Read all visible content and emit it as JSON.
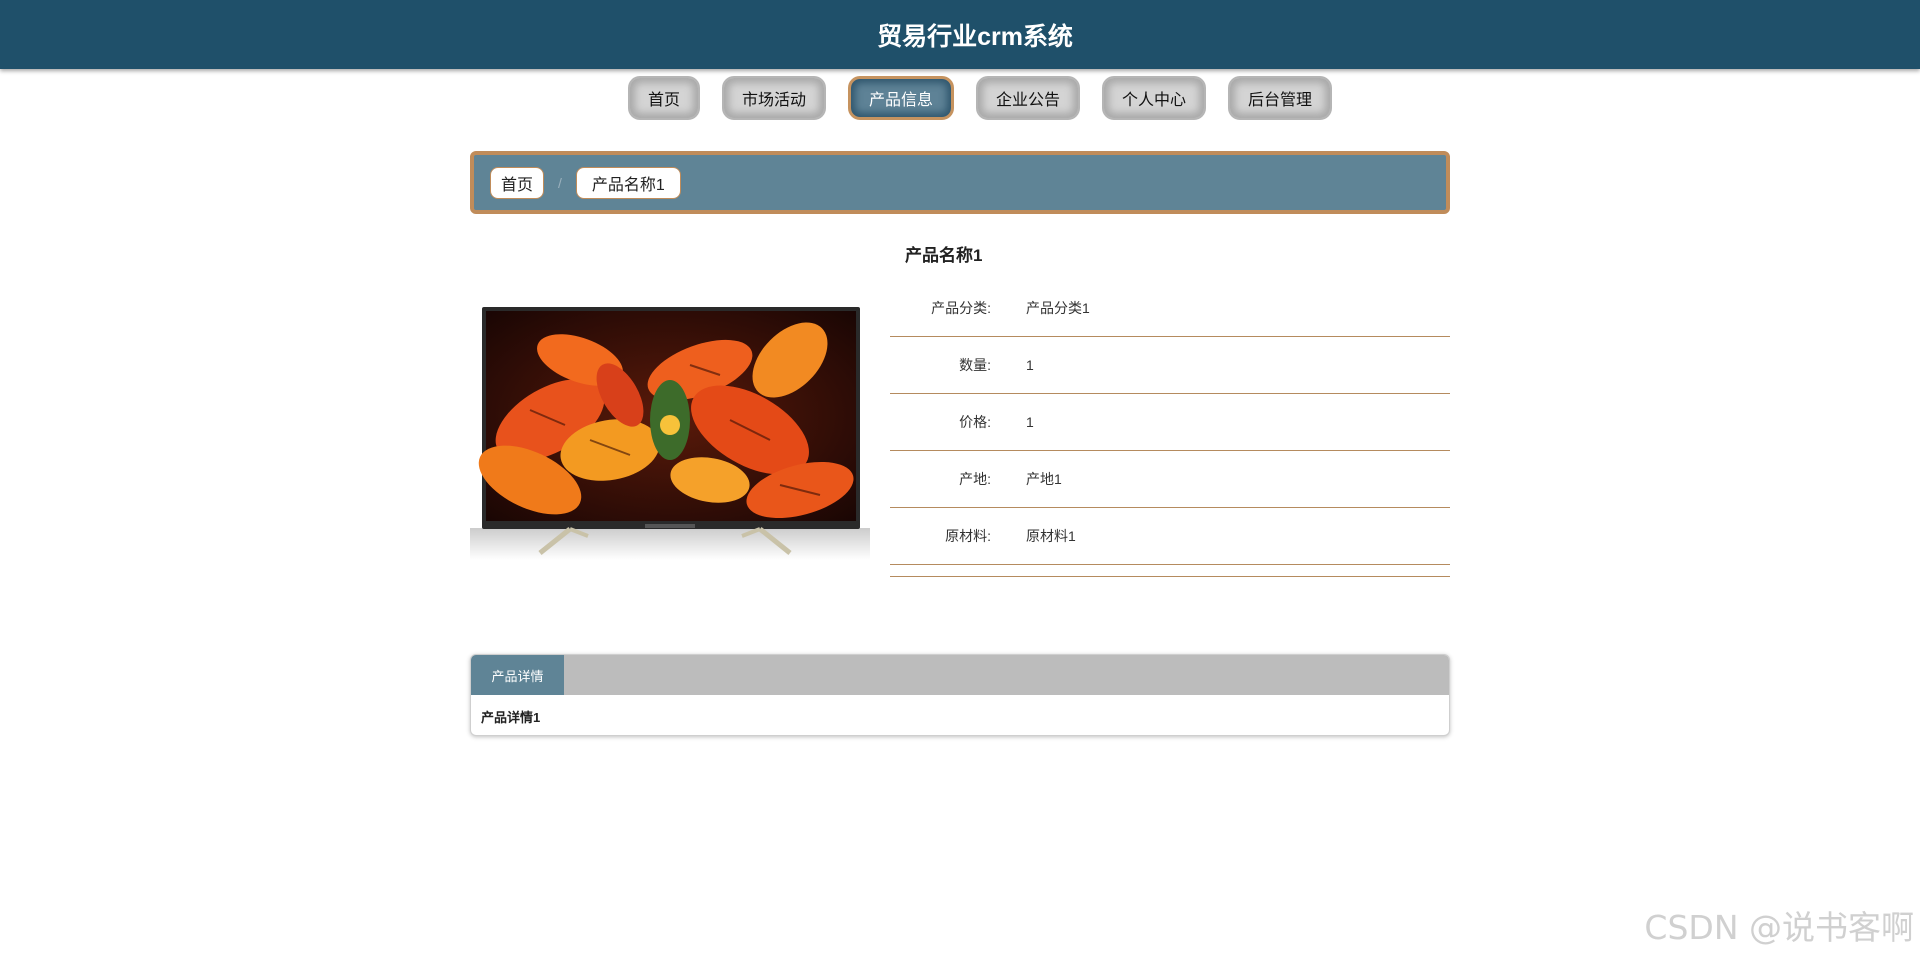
{
  "header": {
    "title": "贸易行业crm系统"
  },
  "nav": {
    "items": [
      {
        "label": "首页"
      },
      {
        "label": "市场活动"
      },
      {
        "label": "产品信息"
      },
      {
        "label": "企业公告"
      },
      {
        "label": "个人中心"
      },
      {
        "label": "后台管理"
      }
    ],
    "active_index": 2
  },
  "breadcrumb": {
    "home": "首页",
    "separator": "/",
    "current": "产品名称1"
  },
  "product": {
    "name": "产品名称1",
    "fields": [
      {
        "label": "产品分类:",
        "value": "产品分类1"
      },
      {
        "label": "数量:",
        "value": "1"
      },
      {
        "label": "价格:",
        "value": "1"
      },
      {
        "label": "产地:",
        "value": "产地1"
      },
      {
        "label": "原材料:",
        "value": "原材料1"
      }
    ],
    "image_icon": "tv-flower-photo"
  },
  "details": {
    "tab_label": "产品详情",
    "content": "产品详情1"
  },
  "watermark": "CSDN @说书客啊",
  "colors": {
    "header_bg": "#1f506a",
    "accent": "#5f8496",
    "border_accent": "#c08c5a"
  }
}
